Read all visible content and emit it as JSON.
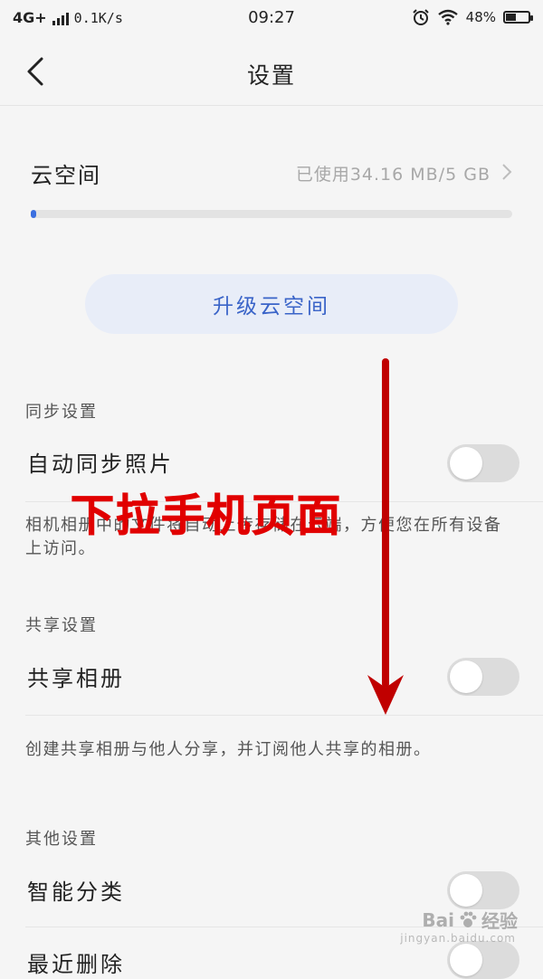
{
  "status_bar": {
    "network": "4G+",
    "speed": "0.1K/s",
    "time": "09:27",
    "battery": "48%",
    "battery_level": 0.48,
    "icons": [
      "alarm-icon",
      "wifi-icon",
      "battery-icon"
    ]
  },
  "header": {
    "title": "设置",
    "back_icon": "back-arrow-icon"
  },
  "cloud": {
    "label": "云空间",
    "usage": "已使用34.16 MB/5 GB",
    "used_fraction": 0.0067,
    "accent": "#3b6fe0"
  },
  "upgrade_button": "升级云空间",
  "sections": {
    "sync": {
      "title": "同步设置",
      "item_label": "自动同步照片",
      "enabled": false,
      "description": "相机相册中的文件将自动上传存储在云端，方便您在所有设备上访问。"
    },
    "share": {
      "title": "共享设置",
      "item_label": "共享相册",
      "enabled": false,
      "description": "创建共享相册与他人分享，并订阅他人共享的相册。"
    },
    "other": {
      "title": "其他设置",
      "items": [
        {
          "label": "智能分类",
          "enabled": false
        },
        {
          "label": "最近删除",
          "enabled": false
        }
      ]
    }
  },
  "overlay": {
    "text": "下拉手机页面",
    "color": "#e10000"
  },
  "watermark": {
    "brand": "Bai",
    "brand_suffix": "经验",
    "url": "jingyan.baidu.com"
  }
}
